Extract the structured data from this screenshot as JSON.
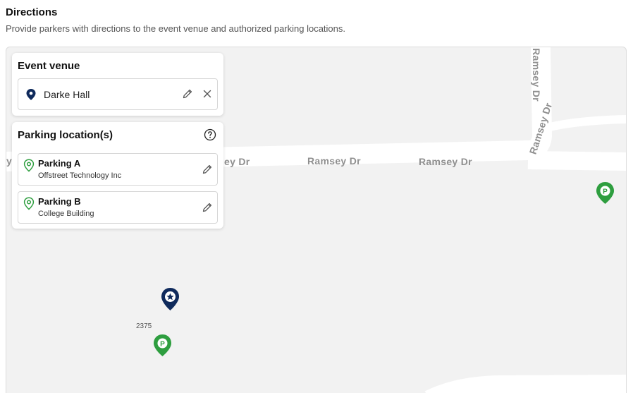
{
  "section": {
    "title": "Directions",
    "description": "Provide parkers with directions to the event venue and authorized parking locations."
  },
  "venue": {
    "title": "Event venue",
    "name": "Darke Hall"
  },
  "parking": {
    "title": "Parking location(s)",
    "items": [
      {
        "name": "Parking A",
        "subtitle": "Offstreet Technology Inc"
      },
      {
        "name": "Parking B",
        "subtitle": "College Building"
      }
    ]
  },
  "map": {
    "road_labels": [
      "y",
      "ey Dr",
      "Ramsey Dr",
      "Ramsey Dr",
      "Ramsey Dr",
      "Ramsey Dr"
    ],
    "number_label": "2375",
    "parking_marker_label": "P"
  },
  "colors": {
    "venue_pin": "#0f2a5c",
    "parking_pin": "#2e9e3f",
    "parking_outline": "#2e9e3f",
    "map_bg": "#f2f2f2",
    "road": "#ffffff",
    "road_text": "#8f8f8f"
  }
}
